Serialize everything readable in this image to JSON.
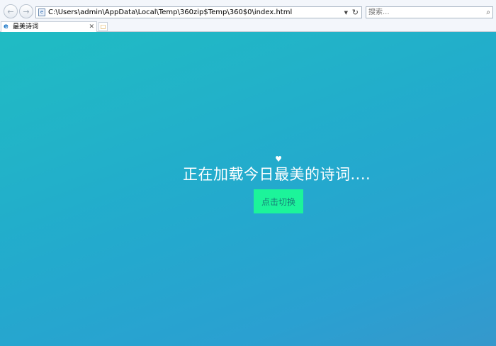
{
  "browser": {
    "address": "C:\\Users\\admin\\AppData\\Local\\Temp\\360zip$Temp\\360$0\\index.html",
    "search_placeholder": "搜索..."
  },
  "tabs": [
    {
      "title": "最美诗词",
      "active": true
    }
  ],
  "icons": {
    "back": "back-arrow-icon",
    "forward": "forward-arrow-icon",
    "page": "page-file-icon",
    "refresh": "refresh-icon",
    "search": "search-icon",
    "tab": "ie-icon",
    "close": "close-icon",
    "new_tab": "new-tab-icon",
    "heart": "heart-icon"
  },
  "page": {
    "loading_text": "正在加载今日最美的诗词....",
    "switch_button": "点击切换"
  },
  "colors": {
    "background_start": "#20bcc3",
    "background_end": "#3598cc",
    "button_bg": "#1cf49a",
    "button_text": "#17807a",
    "text": "#ffffff"
  }
}
